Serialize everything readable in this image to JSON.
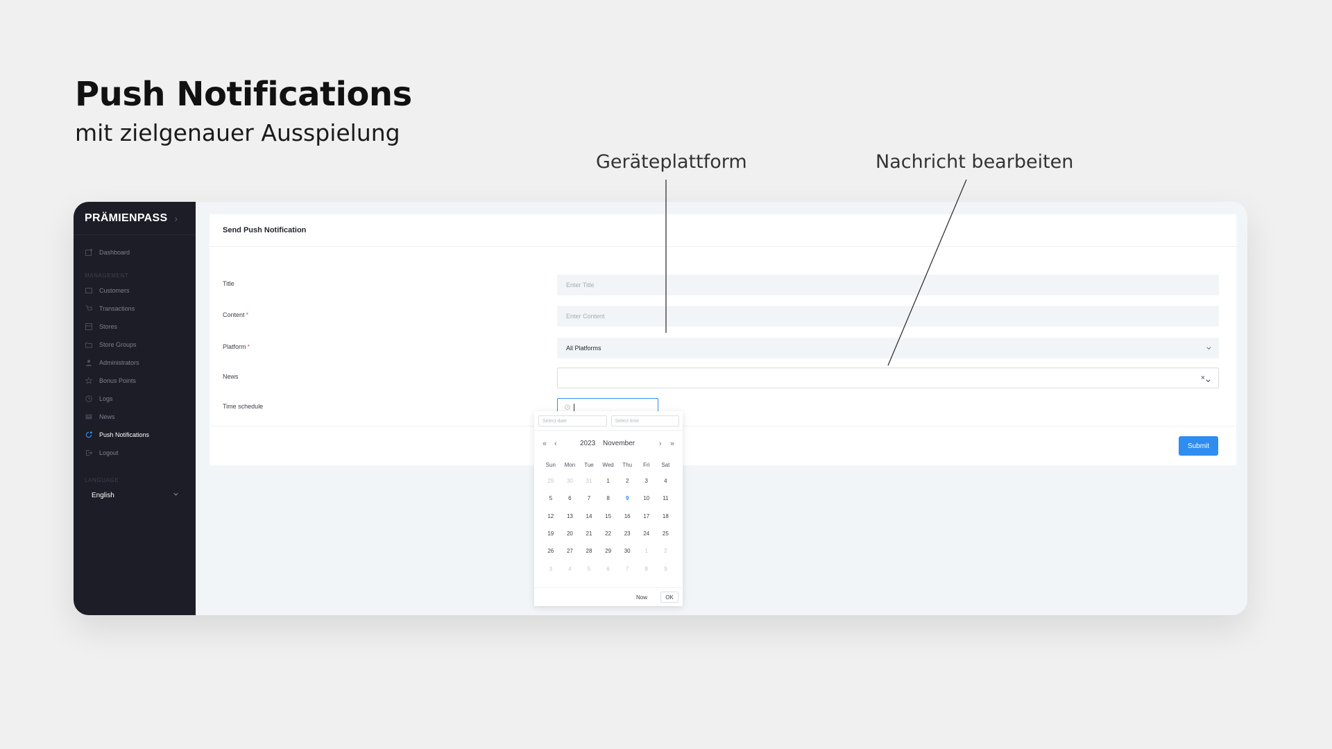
{
  "headline": {
    "title": "Push Notifications",
    "subtitle": "mit zielgenauer Ausspielung"
  },
  "callouts": {
    "platform_label": "Geräteplattform",
    "message_label": "Nachricht bearbeiten"
  },
  "sidebar": {
    "logo": "PRÄMIENPASS",
    "dashboard": {
      "label": "Dashboard",
      "icon": "dashboard-icon"
    },
    "section_management": "MANAGEMENT",
    "items": [
      {
        "label": "Customers",
        "icon": "customers-icon"
      },
      {
        "label": "Transactions",
        "icon": "cart-icon"
      },
      {
        "label": "Stores",
        "icon": "store-icon"
      },
      {
        "label": "Store Groups",
        "icon": "folder-icon"
      },
      {
        "label": "Administrators",
        "icon": "user-icon"
      },
      {
        "label": "Bonus Points",
        "icon": "star-icon"
      },
      {
        "label": "Logs",
        "icon": "clock-icon"
      },
      {
        "label": "News",
        "icon": "news-icon"
      },
      {
        "label": "Push Notifications",
        "icon": "bell-icon",
        "active": true
      },
      {
        "label": "Logout",
        "icon": "logout-icon"
      }
    ],
    "section_language": "LANGUAGE",
    "language": "English"
  },
  "form": {
    "header": "Send Push Notification",
    "title": {
      "label": "Title",
      "placeholder": "Enter Title"
    },
    "content": {
      "label": "Content",
      "placeholder": "Enter Content",
      "required_mark": "*"
    },
    "platform": {
      "label": "Platform",
      "value": "All Platforms",
      "required_mark": "*"
    },
    "news": {
      "label": "News",
      "value": "",
      "clear": "×"
    },
    "time_schedule": {
      "label": "Time schedule"
    },
    "submit": "Submit"
  },
  "datepicker": {
    "date_placeholder": "Select date",
    "time_placeholder": "Select time",
    "year": "2023",
    "month": "November",
    "nav": {
      "prev_year": "«",
      "prev_month": "‹",
      "next_month": "›",
      "next_year": "»"
    },
    "weekdays": [
      "Sun",
      "Mon",
      "Tue",
      "Wed",
      "Thu",
      "Fri",
      "Sat"
    ],
    "days": [
      {
        "d": "29",
        "muted": true
      },
      {
        "d": "30",
        "muted": true
      },
      {
        "d": "31",
        "muted": true
      },
      {
        "d": "1"
      },
      {
        "d": "2"
      },
      {
        "d": "3"
      },
      {
        "d": "4"
      },
      {
        "d": "5"
      },
      {
        "d": "6"
      },
      {
        "d": "7"
      },
      {
        "d": "8"
      },
      {
        "d": "9",
        "today": true
      },
      {
        "d": "10"
      },
      {
        "d": "11"
      },
      {
        "d": "12"
      },
      {
        "d": "13"
      },
      {
        "d": "14"
      },
      {
        "d": "15"
      },
      {
        "d": "16"
      },
      {
        "d": "17"
      },
      {
        "d": "18"
      },
      {
        "d": "19"
      },
      {
        "d": "20"
      },
      {
        "d": "21"
      },
      {
        "d": "22"
      },
      {
        "d": "23"
      },
      {
        "d": "24"
      },
      {
        "d": "25"
      },
      {
        "d": "26"
      },
      {
        "d": "27"
      },
      {
        "d": "28"
      },
      {
        "d": "29"
      },
      {
        "d": "30"
      },
      {
        "d": "1",
        "muted": true
      },
      {
        "d": "2",
        "muted": true
      },
      {
        "d": "3",
        "muted": true
      },
      {
        "d": "4",
        "muted": true
      },
      {
        "d": "5",
        "muted": true
      },
      {
        "d": "6",
        "muted": true
      },
      {
        "d": "7",
        "muted": true
      },
      {
        "d": "8",
        "muted": true
      },
      {
        "d": "9",
        "muted": true
      }
    ],
    "now": "Now",
    "ok": "OK"
  },
  "colors": {
    "accent": "#2f8cf0",
    "sidebar_bg": "#1c1d26",
    "required": "#e34d59"
  }
}
